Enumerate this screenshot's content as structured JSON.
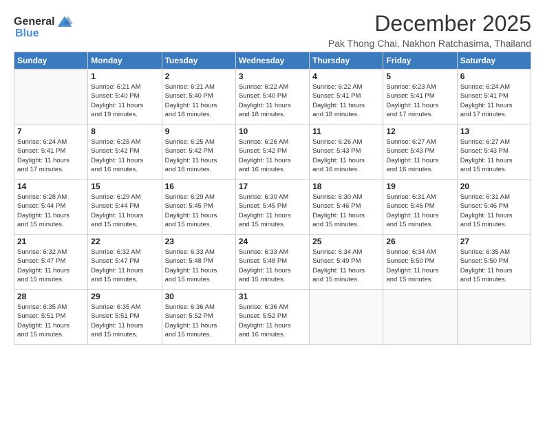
{
  "logo": {
    "text_general": "General",
    "text_blue": "Blue"
  },
  "title": "December 2025",
  "subtitle": "Pak Thong Chai, Nakhon Ratchasima, Thailand",
  "days_of_week": [
    "Sunday",
    "Monday",
    "Tuesday",
    "Wednesday",
    "Thursday",
    "Friday",
    "Saturday"
  ],
  "weeks": [
    [
      {
        "day": "",
        "info": ""
      },
      {
        "day": "1",
        "info": "Sunrise: 6:21 AM\nSunset: 5:40 PM\nDaylight: 11 hours\nand 19 minutes."
      },
      {
        "day": "2",
        "info": "Sunrise: 6:21 AM\nSunset: 5:40 PM\nDaylight: 11 hours\nand 18 minutes."
      },
      {
        "day": "3",
        "info": "Sunrise: 6:22 AM\nSunset: 5:40 PM\nDaylight: 11 hours\nand 18 minutes."
      },
      {
        "day": "4",
        "info": "Sunrise: 6:22 AM\nSunset: 5:41 PM\nDaylight: 11 hours\nand 18 minutes."
      },
      {
        "day": "5",
        "info": "Sunrise: 6:23 AM\nSunset: 5:41 PM\nDaylight: 11 hours\nand 17 minutes."
      },
      {
        "day": "6",
        "info": "Sunrise: 6:24 AM\nSunset: 5:41 PM\nDaylight: 11 hours\nand 17 minutes."
      }
    ],
    [
      {
        "day": "7",
        "info": "Sunrise: 6:24 AM\nSunset: 5:41 PM\nDaylight: 11 hours\nand 17 minutes."
      },
      {
        "day": "8",
        "info": "Sunrise: 6:25 AM\nSunset: 5:42 PM\nDaylight: 11 hours\nand 16 minutes."
      },
      {
        "day": "9",
        "info": "Sunrise: 6:25 AM\nSunset: 5:42 PM\nDaylight: 11 hours\nand 16 minutes."
      },
      {
        "day": "10",
        "info": "Sunrise: 6:26 AM\nSunset: 5:42 PM\nDaylight: 11 hours\nand 16 minutes."
      },
      {
        "day": "11",
        "info": "Sunrise: 6:26 AM\nSunset: 5:43 PM\nDaylight: 11 hours\nand 16 minutes."
      },
      {
        "day": "12",
        "info": "Sunrise: 6:27 AM\nSunset: 5:43 PM\nDaylight: 11 hours\nand 16 minutes."
      },
      {
        "day": "13",
        "info": "Sunrise: 6:27 AM\nSunset: 5:43 PM\nDaylight: 11 hours\nand 15 minutes."
      }
    ],
    [
      {
        "day": "14",
        "info": "Sunrise: 6:28 AM\nSunset: 5:44 PM\nDaylight: 11 hours\nand 15 minutes."
      },
      {
        "day": "15",
        "info": "Sunrise: 6:29 AM\nSunset: 5:44 PM\nDaylight: 11 hours\nand 15 minutes."
      },
      {
        "day": "16",
        "info": "Sunrise: 6:29 AM\nSunset: 5:45 PM\nDaylight: 11 hours\nand 15 minutes."
      },
      {
        "day": "17",
        "info": "Sunrise: 6:30 AM\nSunset: 5:45 PM\nDaylight: 11 hours\nand 15 minutes."
      },
      {
        "day": "18",
        "info": "Sunrise: 6:30 AM\nSunset: 5:46 PM\nDaylight: 11 hours\nand 15 minutes."
      },
      {
        "day": "19",
        "info": "Sunrise: 6:31 AM\nSunset: 5:46 PM\nDaylight: 11 hours\nand 15 minutes."
      },
      {
        "day": "20",
        "info": "Sunrise: 6:31 AM\nSunset: 5:46 PM\nDaylight: 11 hours\nand 15 minutes."
      }
    ],
    [
      {
        "day": "21",
        "info": "Sunrise: 6:32 AM\nSunset: 5:47 PM\nDaylight: 11 hours\nand 15 minutes."
      },
      {
        "day": "22",
        "info": "Sunrise: 6:32 AM\nSunset: 5:47 PM\nDaylight: 11 hours\nand 15 minutes."
      },
      {
        "day": "23",
        "info": "Sunrise: 6:33 AM\nSunset: 5:48 PM\nDaylight: 11 hours\nand 15 minutes."
      },
      {
        "day": "24",
        "info": "Sunrise: 6:33 AM\nSunset: 5:48 PM\nDaylight: 11 hours\nand 15 minutes."
      },
      {
        "day": "25",
        "info": "Sunrise: 6:34 AM\nSunset: 5:49 PM\nDaylight: 11 hours\nand 15 minutes."
      },
      {
        "day": "26",
        "info": "Sunrise: 6:34 AM\nSunset: 5:50 PM\nDaylight: 11 hours\nand 15 minutes."
      },
      {
        "day": "27",
        "info": "Sunrise: 6:35 AM\nSunset: 5:50 PM\nDaylight: 11 hours\nand 15 minutes."
      }
    ],
    [
      {
        "day": "28",
        "info": "Sunrise: 6:35 AM\nSunset: 5:51 PM\nDaylight: 11 hours\nand 15 minutes."
      },
      {
        "day": "29",
        "info": "Sunrise: 6:35 AM\nSunset: 5:51 PM\nDaylight: 11 hours\nand 15 minutes."
      },
      {
        "day": "30",
        "info": "Sunrise: 6:36 AM\nSunset: 5:52 PM\nDaylight: 11 hours\nand 15 minutes."
      },
      {
        "day": "31",
        "info": "Sunrise: 6:36 AM\nSunset: 5:52 PM\nDaylight: 11 hours\nand 16 minutes."
      },
      {
        "day": "",
        "info": ""
      },
      {
        "day": "",
        "info": ""
      },
      {
        "day": "",
        "info": ""
      }
    ]
  ]
}
